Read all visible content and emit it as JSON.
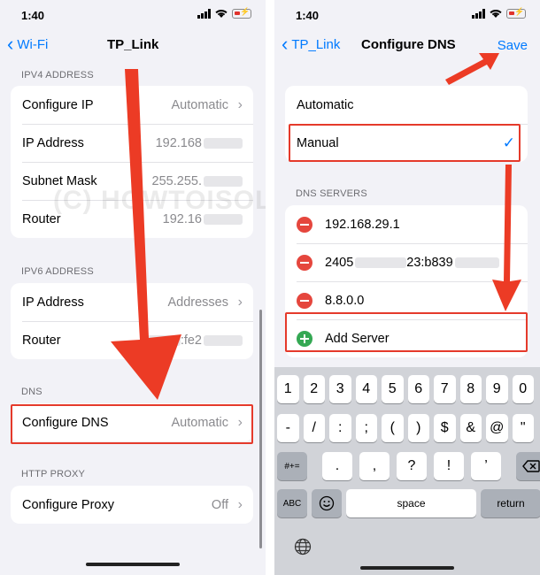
{
  "left": {
    "status": {
      "time": "1:40"
    },
    "nav": {
      "back_label": "Wi-Fi",
      "title": "TP_Link"
    },
    "watermark": "(C) HOWTOISOLVE.COM",
    "ipv4": {
      "header": "IPV4 ADDRESS",
      "rows": [
        {
          "label": "Configure IP",
          "value": "Automatic"
        },
        {
          "label": "IP Address",
          "value": "192.168"
        },
        {
          "label": "Subnet Mask",
          "value": "255.255."
        },
        {
          "label": "Router",
          "value": "192.16"
        }
      ]
    },
    "ipv6": {
      "header": "IPV6 ADDRESS",
      "rows": [
        {
          "label": "IP Address",
          "value": "Addresses"
        },
        {
          "label": "Router",
          "value": ":fe2"
        }
      ]
    },
    "dns": {
      "header": "DNS",
      "label": "Configure DNS",
      "value": "Automatic"
    },
    "proxy": {
      "header": "HTTP PROXY",
      "label": "Configure Proxy",
      "value": "Off"
    }
  },
  "right": {
    "status": {
      "time": "1:40"
    },
    "nav": {
      "back_label": "TP_Link",
      "title": "Configure DNS",
      "save_label": "Save"
    },
    "modes": [
      {
        "label": "Automatic"
      },
      {
        "label": "Manual",
        "checked": true
      }
    ],
    "servers": {
      "header": "DNS SERVERS",
      "items": [
        "192.168.29.1",
        "2405",
        "8.8.0.0"
      ],
      "item2_mid": "23:b839",
      "add_label": "Add Server"
    },
    "keyboard": {
      "row1": [
        "1",
        "2",
        "3",
        "4",
        "5",
        "6",
        "7",
        "8",
        "9",
        "0"
      ],
      "row2": [
        "-",
        "/",
        ":",
        ";",
        "(",
        ")",
        "$",
        "&",
        "@",
        "\""
      ],
      "row3_left": "#+=",
      "row3_keys": [
        ".",
        ",",
        "?",
        "!",
        "’"
      ],
      "abc": "ABC",
      "space": "space",
      "return": "return"
    }
  },
  "colors": {
    "accent": "#007aff",
    "highlight": "#e53a2b",
    "delete": "#e5463d",
    "add": "#34a853"
  }
}
